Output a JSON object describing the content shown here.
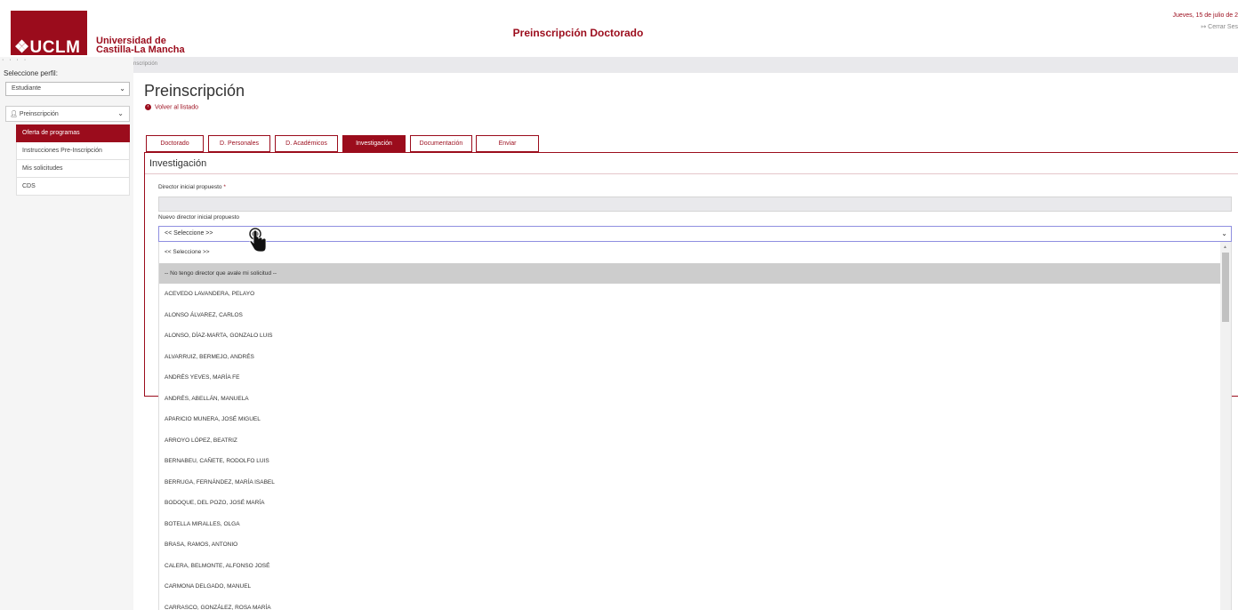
{
  "header": {
    "logo": "❖UCLM",
    "university_line1": "Universidad de",
    "university_line2": "Castilla-La Mancha",
    "app_title": "Preinscripción Doctorado",
    "date": "Jueves, 15 de julio de 2",
    "logout": "Cerrar Ses"
  },
  "breadcrumb": {
    "left": "· · · ·",
    "text": "nscripción"
  },
  "sidebar": {
    "profile_label": "Seleccione perfil:",
    "profile_value": "Estudiante",
    "menu_head": "Preinscripción",
    "items": [
      {
        "label": "Oferta de programas"
      },
      {
        "label": "Instrucciones Pre-Inscripción"
      },
      {
        "label": "Mis solicitudes"
      },
      {
        "label": "CDS"
      }
    ]
  },
  "main": {
    "title": "Preinscripción",
    "back_link": "Volver al listado",
    "tabs": [
      {
        "label": "Doctorado"
      },
      {
        "label": "D. Personales"
      },
      {
        "label": "D. Académicos"
      },
      {
        "label": "Investigación"
      },
      {
        "label": "Documentación"
      },
      {
        "label": "Enviar"
      }
    ],
    "panel_title": "Investigación",
    "field1_label": "Director inicial propuesto",
    "field1_required": "*",
    "field2_label": "Nuevo director inicial propuesto",
    "select_value": "<< Seleccione >>"
  },
  "dropdown": {
    "options": [
      "<< Seleccione >>",
      "-- No tengo director que avale mi solicitud --",
      "ACEVEDO LAVANDERA, PELAYO",
      "ALONSO ÁLVAREZ, CARLOS",
      "ALONSO, DÍAZ-MARTA, GONZALO LUIS",
      "ALVARRUIZ, BERMEJO, ANDRÉS",
      "ANDRÉS YEVES, MARÍA FE",
      "ANDRÉS, ABELLÁN, MANUELA",
      "APARICIO MUNERA, JOSÉ MIGUEL",
      "ARROYO LÓPEZ, BEATRIZ",
      "BERNABEU, CAÑETE, RODOLFO LUIS",
      "BERRUGA, FERNÁNDEZ, MARÍA ISABEL",
      "BODOQUE, DEL POZO, JOSÉ MARÍA",
      "BOTELLA MIRALLES, OLGA",
      "BRASA, RAMOS, ANTONIO",
      "CALERA, BELMONTE, ALFONSO JOSÉ",
      "CARMONA DELGADO, MANUEL",
      "CARRASCO, GONZÁLEZ, ROSA MARÍA"
    ]
  },
  "colors": {
    "brand": "#9b0c1c",
    "highlight": "#cdcdcd"
  }
}
